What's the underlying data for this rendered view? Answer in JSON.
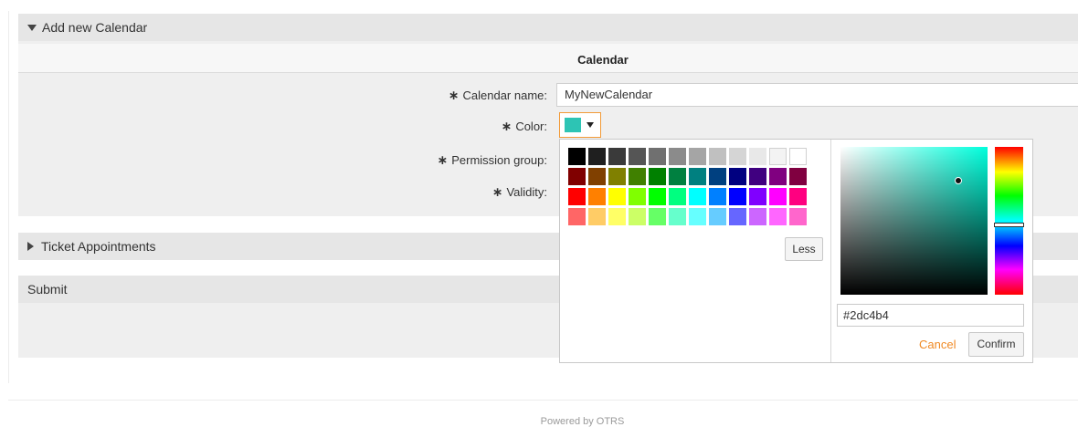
{
  "add_calendar": {
    "header_label": "Add new Calendar",
    "section_title": "Calendar",
    "required_marker": "∗",
    "fields": {
      "calendar_name": {
        "label": "Calendar name:",
        "value": "MyNewCalendar"
      },
      "color": {
        "label": "Color:",
        "current_color": "#2dc4b4"
      },
      "permission_group": {
        "label": "Permission group:"
      },
      "validity": {
        "label": "Validity:"
      }
    }
  },
  "color_picker": {
    "palette": [
      [
        "#000000",
        "#1f1f1f",
        "#3a3a3a",
        "#555555",
        "#707070",
        "#8b8b8b",
        "#a5a5a5",
        "#c0c0c0",
        "#d5d5d5",
        "#e8e8e8",
        "#f3f3f3",
        "#ffffff"
      ],
      [
        "#800000",
        "#804000",
        "#808000",
        "#408000",
        "#008000",
        "#008040",
        "#008080",
        "#004080",
        "#000080",
        "#400080",
        "#800080",
        "#800040"
      ],
      [
        "#ff0000",
        "#ff8000",
        "#ffff00",
        "#80ff00",
        "#00ff00",
        "#00ff80",
        "#00ffff",
        "#0080ff",
        "#0000ff",
        "#8000ff",
        "#ff00ff",
        "#ff0080"
      ],
      [
        "#ff6666",
        "#ffcc66",
        "#ffff66",
        "#ccff66",
        "#66ff66",
        "#66ffcc",
        "#66ffff",
        "#66ccff",
        "#6666ff",
        "#cc66ff",
        "#ff66ff",
        "#ff66cc"
      ]
    ],
    "less_label": "Less",
    "spectrum_hue_color": "#00ffdd",
    "hex_value": "#2dc4b4",
    "cancel_label": "Cancel",
    "confirm_label": "Confirm"
  },
  "ticket_appointments": {
    "header_label": "Ticket Appointments"
  },
  "submit": {
    "header_label": "Submit"
  },
  "footer": {
    "text": "Powered by OTRS"
  },
  "colors": {
    "accent": "#f08a24",
    "header_bg": "#e6e6e6",
    "body_bg": "#efefef"
  }
}
